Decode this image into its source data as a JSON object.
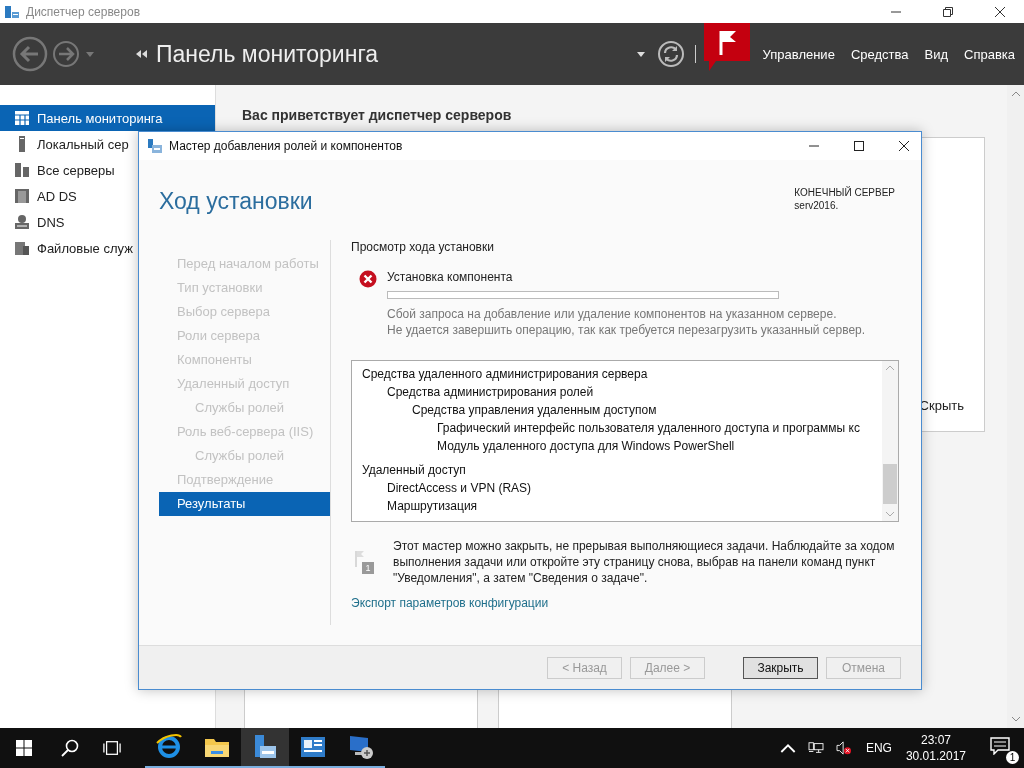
{
  "window": {
    "title": "Диспетчер серверов"
  },
  "header": {
    "title": "Панель мониторинга",
    "menu": [
      "Управление",
      "Средства",
      "Вид",
      "Справка"
    ]
  },
  "sidebar": {
    "items": [
      {
        "label": "Панель мониторинга",
        "selected": true
      },
      {
        "label": "Локальный сер",
        "selected": false
      },
      {
        "label": "Все серверы",
        "selected": false
      },
      {
        "label": "AD DS",
        "selected": false
      },
      {
        "label": "DNS",
        "selected": false
      },
      {
        "label": "Файловые служ",
        "selected": false
      }
    ]
  },
  "main": {
    "welcome": "Вас приветствует диспетчер серверов",
    "hide_link": "Скрыть"
  },
  "dialog": {
    "title": "Мастер добавления ролей и компонентов",
    "heading": "Ход установки",
    "target_server": {
      "label": "КОНЕЧНЫЙ СЕРВЕР",
      "name": "serv2016."
    },
    "steps": [
      {
        "label": "Перед началом работы",
        "selected": false
      },
      {
        "label": "Тип установки",
        "selected": false
      },
      {
        "label": "Выбор сервера",
        "selected": false
      },
      {
        "label": "Роли сервера",
        "selected": false
      },
      {
        "label": "Компоненты",
        "selected": false
      },
      {
        "label": "Удаленный доступ",
        "selected": false,
        "children": [
          {
            "label": "Службы ролей",
            "selected": false
          }
        ]
      },
      {
        "label": "Роль веб-сервера (IIS)",
        "selected": false,
        "children": [
          {
            "label": "Службы ролей",
            "selected": false
          }
        ]
      },
      {
        "label": "Подтверждение",
        "selected": false
      },
      {
        "label": "Результаты",
        "selected": true
      }
    ],
    "section_title": "Просмотр хода установки",
    "task": {
      "failed": true,
      "label": "Установка компонента",
      "level": 0,
      "messages": [
        "Сбой запроса на добавление или удаление компонентов на указанном сервере.",
        "Не удается завершить операцию, так как требуется перезагрузить указанный сервер."
      ]
    },
    "features": [
      {
        "label": "Средства удаленного администрирования сервера",
        "children": [
          {
            "label": "Средства администрирования ролей",
            "children": [
              {
                "label": "Средства управления удаленным доступом",
                "children": [
                  {
                    "label": "Графический интерфейс пользователя удаленного доступа и программы кс"
                  },
                  {
                    "label": "Модуль удаленного доступа для Windows PowerShell"
                  }
                ]
              }
            ]
          }
        ]
      },
      {
        "label": "Удаленный доступ",
        "children": [
          {
            "label": "DirectAccess и VPN (RAS)"
          },
          {
            "label": "Маршрутизация"
          }
        ]
      }
    ],
    "notice": {
      "badge": "1",
      "text": "Этот мастер можно закрыть, не прерывая выполняющиеся задачи. Наблюдайте за ходом выполнения задачи или откройте эту страницу снова, выбрав на панели команд пункт \"Уведомления\", а затем \"Сведения о задаче\"."
    },
    "export_link": "Экспорт параметров конфигурации",
    "buttons": [
      {
        "label": "< Назад",
        "disabled": true,
        "default": false
      },
      {
        "label": "Далее >",
        "disabled": true,
        "default": false
      },
      {
        "label": "Закрыть",
        "disabled": false,
        "default": true
      },
      {
        "label": "Отмена",
        "disabled": true,
        "default": false
      }
    ]
  },
  "taskbar": {
    "apps": [
      {
        "selected": false
      },
      {
        "selected": false
      },
      {
        "selected": true
      },
      {
        "selected": false
      },
      {
        "selected": false
      }
    ],
    "language": "ENG",
    "time": "23:07",
    "date": "30.01.2017",
    "notifications": "1"
  }
}
